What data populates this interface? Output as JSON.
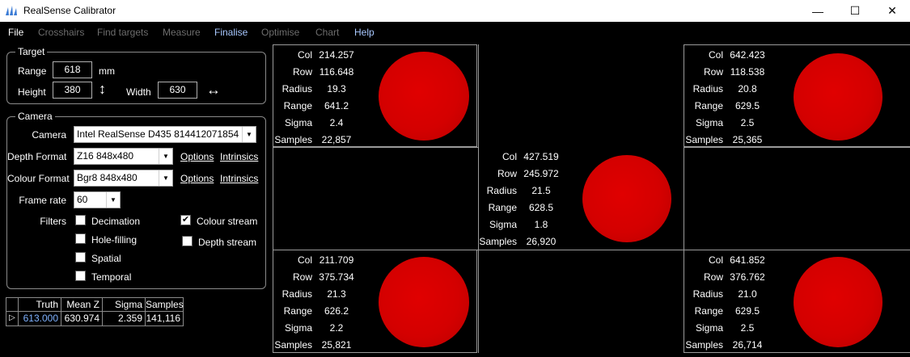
{
  "window": {
    "title": "RealSense Calibrator",
    "minimize_glyph": "—",
    "maximize_glyph": "☐",
    "close_glyph": "✕"
  },
  "menu": [
    {
      "label": "File",
      "state": "enabled"
    },
    {
      "label": "Crosshairs",
      "state": "disabled"
    },
    {
      "label": "Find targets",
      "state": "disabled"
    },
    {
      "label": "Measure",
      "state": "disabled"
    },
    {
      "label": "Finalise",
      "state": "accent"
    },
    {
      "label": "Optimise",
      "state": "disabled"
    },
    {
      "label": "Chart",
      "state": "disabled"
    },
    {
      "label": "Help",
      "state": "accent"
    }
  ],
  "target": {
    "title": "Target",
    "range_label": "Range",
    "range_value": "618",
    "range_unit": "mm",
    "height_label": "Height",
    "height_value": "380",
    "height_arrow": "↕",
    "width_label": "Width",
    "width_value": "630",
    "width_arrow": "↔"
  },
  "camera": {
    "title": "Camera",
    "camera_label": "Camera",
    "camera_value": "Intel RealSense D435 814412071854",
    "depth_format_label": "Depth Format",
    "depth_format_value": "Z16 848x480",
    "colour_format_label": "Colour Format",
    "colour_format_value": "Bgr8 848x480",
    "options_label": "Options",
    "intrinsics_label": "Intrinsics",
    "frame_rate_label": "Frame rate",
    "frame_rate_value": "60",
    "filters_label": "Filters",
    "filters": [
      {
        "label": "Decimation",
        "checked": false
      },
      {
        "label": "Hole-filling",
        "checked": false
      },
      {
        "label": "Spatial",
        "checked": false
      },
      {
        "label": "Temporal",
        "checked": false
      }
    ],
    "streams": [
      {
        "label": "Colour stream",
        "checked": true
      },
      {
        "label": "Depth stream",
        "checked": false
      }
    ],
    "check_glyph": "✔",
    "dropdown_glyph": "▼"
  },
  "grid": {
    "row_marker": "▷",
    "headers": [
      "Truth",
      "Mean Z",
      "Sigma",
      "Samples"
    ],
    "row": [
      "613.000",
      "630.974",
      "2.359",
      "141,116"
    ],
    "truth_color": "#7fb2ff"
  },
  "stat_labels": [
    "Col",
    "Row",
    "Radius",
    "Range",
    "Sigma",
    "Samples"
  ],
  "targets": [
    {
      "position": "top-left",
      "values": [
        "214.257",
        "116.648",
        "19.3",
        "641.2",
        "2.4",
        "22,857"
      ]
    },
    {
      "position": "top-right",
      "values": [
        "642.423",
        "118.538",
        "20.8",
        "629.5",
        "2.5",
        "25,365"
      ]
    },
    {
      "position": "center",
      "values": [
        "427.519",
        "245.972",
        "21.5",
        "628.5",
        "1.8",
        "26,920"
      ]
    },
    {
      "position": "bottom-left",
      "values": [
        "211.709",
        "375.734",
        "21.3",
        "626.2",
        "2.2",
        "25,821"
      ]
    },
    {
      "position": "bottom-right",
      "values": [
        "641.852",
        "376.762",
        "21.0",
        "629.5",
        "2.5",
        "26,714"
      ]
    }
  ],
  "colors": {
    "background": "#000000",
    "blob_red": "#dd0000",
    "border": "#9a9a9a"
  }
}
